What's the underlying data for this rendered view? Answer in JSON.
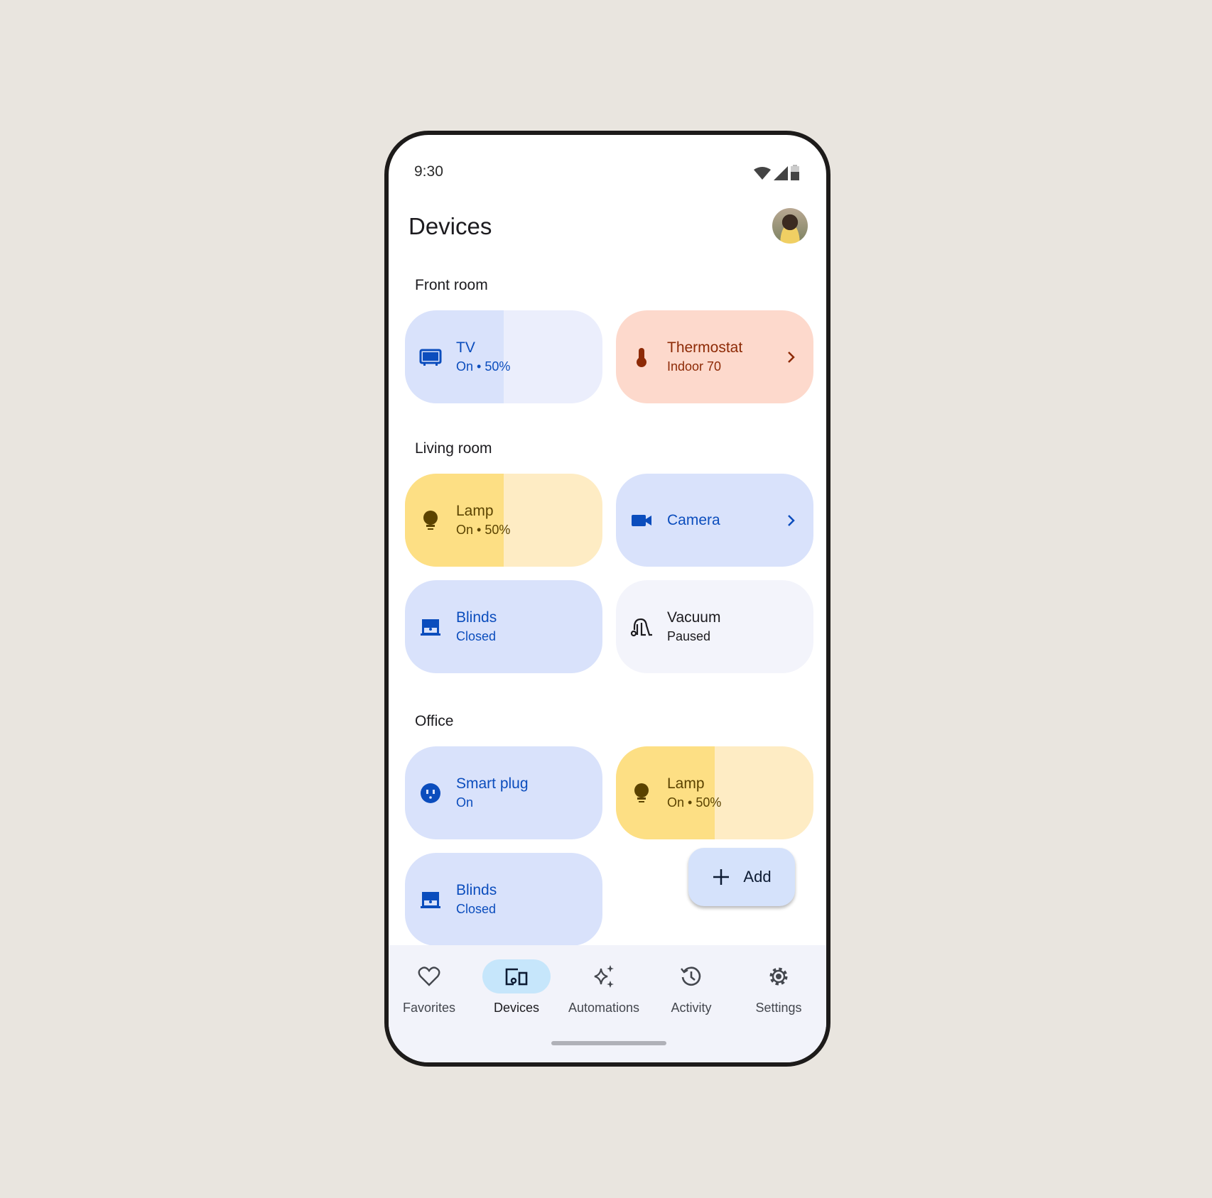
{
  "status_bar": {
    "time": "9:30",
    "icons": [
      "wifi-icon",
      "signal-icon",
      "battery-icon"
    ]
  },
  "header": {
    "title": "Devices",
    "avatar": "user-avatar"
  },
  "sections": [
    {
      "label": "Front room",
      "devices": [
        {
          "name": "TV",
          "status": "On • 50%",
          "icon": "tv-icon",
          "level_percent": 50,
          "color": "#0b4dbd"
        },
        {
          "name": "Thermostat",
          "status": "Indoor 70",
          "icon": "thermostat-icon",
          "chevron": true,
          "color": "#8d2a06"
        }
      ]
    },
    {
      "label": "Living room",
      "devices": [
        {
          "name": "Lamp",
          "status": "On • 50%",
          "icon": "lightbulb-icon",
          "level_percent": 50,
          "color": "#5b4300"
        },
        {
          "name": "Camera",
          "status": "",
          "icon": "videocam-icon",
          "chevron": true,
          "color": "#0b4dbd"
        },
        {
          "name": "Blinds",
          "status": "Closed",
          "icon": "blinds-icon",
          "color": "#0b4dbd"
        },
        {
          "name": "Vacuum",
          "status": "Paused",
          "icon": "vacuum-icon",
          "color": "#1c1b1f"
        }
      ]
    },
    {
      "label": "Office",
      "devices": [
        {
          "name": "Smart plug",
          "status": "On",
          "icon": "outlet-icon",
          "color": "#0b4dbd"
        },
        {
          "name": "Lamp",
          "status": "On • 50%",
          "icon": "lightbulb-icon",
          "level_percent": 50,
          "color": "#5b4300"
        },
        {
          "name": "Blinds",
          "status": "Closed",
          "icon": "blinds-icon",
          "color": "#0b4dbd"
        }
      ]
    }
  ],
  "fab": {
    "label": "Add",
    "icon": "plus-icon"
  },
  "nav": {
    "active": "Devices",
    "items": [
      {
        "label": "Favorites",
        "icon": "heart-icon"
      },
      {
        "label": "Devices",
        "icon": "devices-icon"
      },
      {
        "label": "Automations",
        "icon": "sparkle-icon"
      },
      {
        "label": "Activity",
        "icon": "history-icon"
      },
      {
        "label": "Settings",
        "icon": "gear-icon"
      }
    ]
  }
}
